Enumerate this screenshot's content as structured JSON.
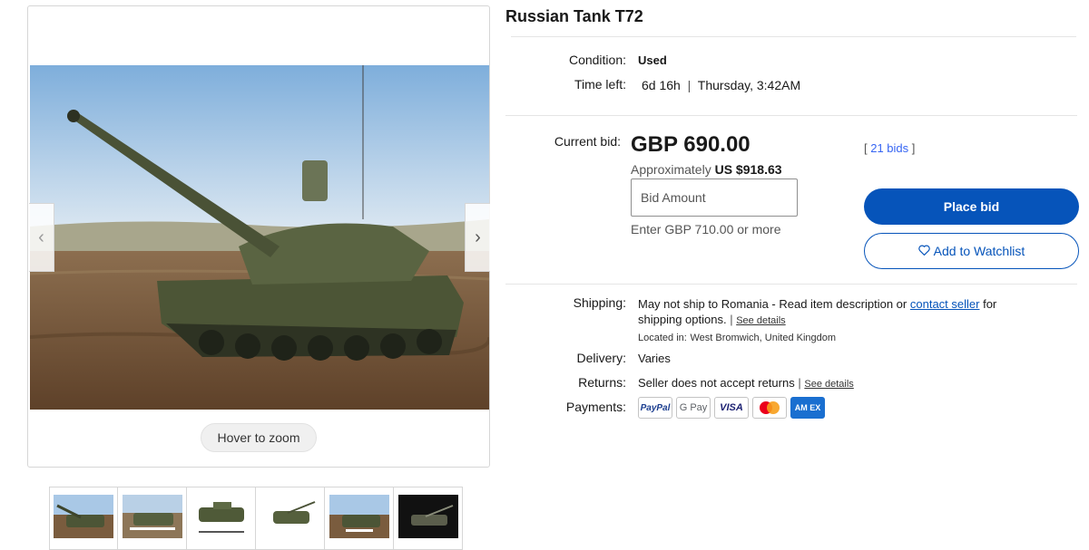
{
  "listing": {
    "title": "Russian Tank T72"
  },
  "gallery": {
    "main_image": "tank-photo",
    "zoom_hint": "Hover to zoom",
    "thumbnails": [
      {
        "caption": ""
      },
      {
        "caption": ""
      },
      {
        "caption": ""
      },
      {
        "caption": ""
      },
      {
        "caption": ""
      },
      {
        "caption": ""
      }
    ]
  },
  "details": {
    "condition_label": "Condition:",
    "condition_value": "Used",
    "time_left_label": "Time left:",
    "time_left_value": "6d 16h",
    "time_left_end": "Thursday, 3:42AM"
  },
  "bidding": {
    "current_bid_label": "Current bid:",
    "current_bid_value": "GBP 690.00",
    "approx_prefix": "Approximately",
    "approx_value": "US $918.63",
    "bids_count": "21 bids",
    "bid_input_placeholder": "Bid Amount",
    "min_bid_hint": "Enter GBP 710.00 or more",
    "place_bid_label": "Place bid",
    "watchlist_label": "Add to Watchlist"
  },
  "shipping": {
    "shipping_label": "Shipping:",
    "shipping_text_1": "May not ship to Romania - Read item description or",
    "contact_seller": "contact seller",
    "shipping_text_2": "for",
    "shipping_text_3": "shipping options.",
    "see_details": "See details",
    "located_in_label": "Located in:",
    "located_in_value": "West Bromwich, United Kingdom",
    "delivery_label": "Delivery:",
    "delivery_value": "Varies",
    "returns_label": "Returns:",
    "returns_value": "Seller does not accept returns",
    "returns_see_details": "See details",
    "payments_label": "Payments:"
  },
  "payment_methods": {
    "paypal": "PayPal",
    "gpay": "G Pay",
    "visa": "VISA",
    "mastercard": "",
    "amex": "AM EX"
  },
  "colors": {
    "accent": "#0654ba",
    "link": "#3665f3"
  }
}
